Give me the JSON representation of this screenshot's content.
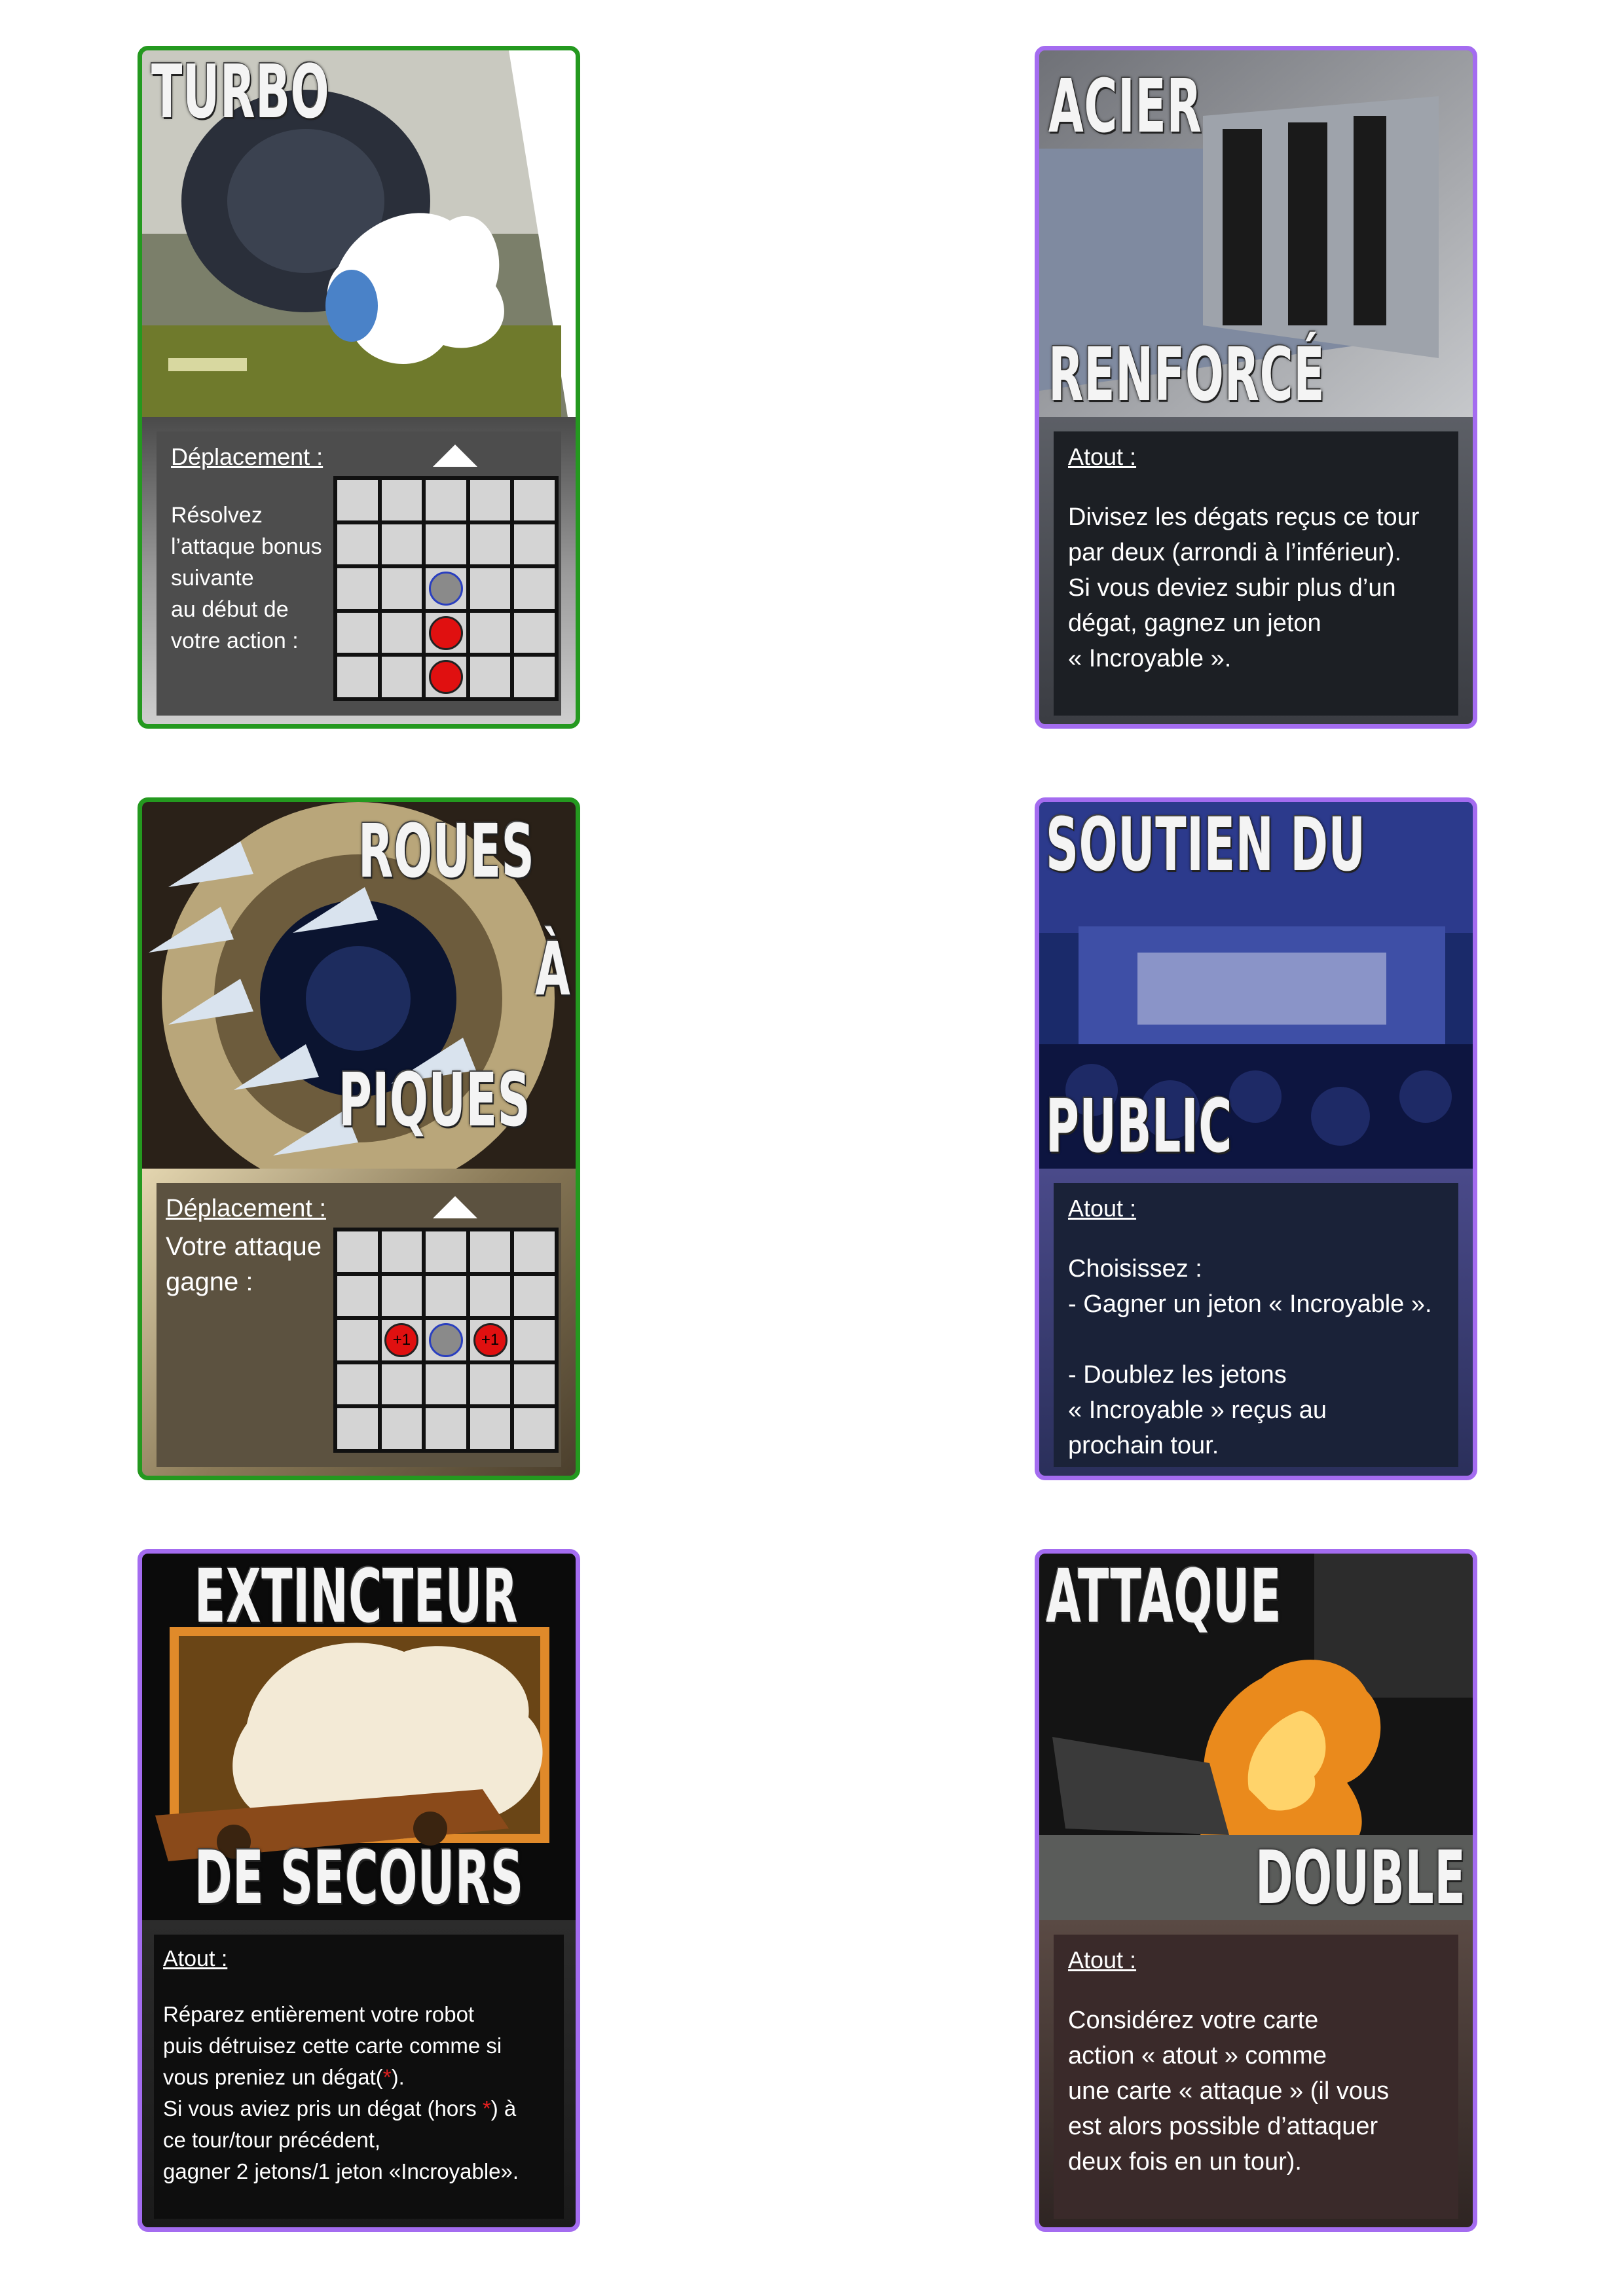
{
  "cards": [
    {
      "title": "TURBO",
      "section_label": "Déplacement :",
      "text": "Résolvez\nl’attaque bonus\nsuivante\nau début de\nvotre action :"
    },
    {
      "title_top": "ACIER",
      "title_bottom": "RENFORCÉ",
      "section_label": "Atout :",
      "text": "Divisez les dégats reçus ce tour\npar deux (arrondi à l’inférieur).\nSi vous deviez subir plus d’un\ndégat, gagnez un jeton\n« Incroyable »."
    },
    {
      "title_lines": [
        "ROUES",
        "À",
        "PIQUES"
      ],
      "section_label": "Déplacement :",
      "text": "Votre attaque\ngagne :",
      "bonus_left": "+1",
      "bonus_right": "+1"
    },
    {
      "title_top": "SOUTIEN DU",
      "title_bottom": "PUBLIC",
      "section_label": "Atout :",
      "text": "Choisissez :\n- Gagner un jeton « Incroyable ».\n\n- Doublez les jetons\n« Incroyable » reçus au\nprochain tour."
    },
    {
      "title_top": "EXTINCTEUR",
      "title_bottom": "DE SECOURS",
      "section_label": "Atout :",
      "text_1": "Réparez entièrement votre robot\npuis détruisez cette carte comme si\nvous preniez un dégat(",
      "asterisk": "*",
      "text_2": ").\nSi vous aviez pris un dégat (hors ",
      "text_3": ") à\nce tour/tour précédent,\ngagner 2 jetons/1 jeton «Incroyable»."
    },
    {
      "title_top": "ATTAQUE",
      "title_bottom": "DOUBLE",
      "section_label": "Atout :",
      "text": "Considérez votre carte\naction « atout » comme\nune carte « attaque » (il vous\nest alors possible d’attaquer\ndeux fois en un tour)."
    }
  ]
}
